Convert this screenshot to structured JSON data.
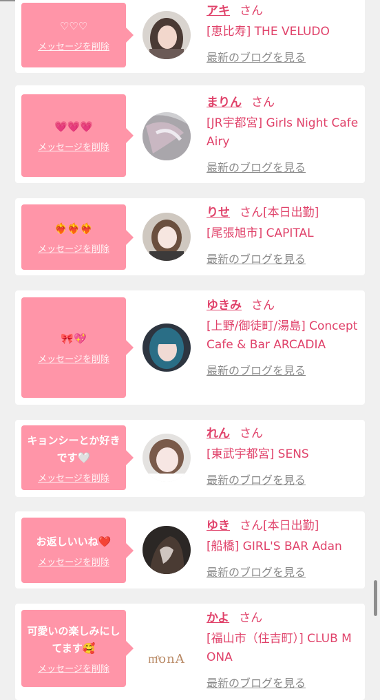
{
  "colors": {
    "accent": "#e0426a",
    "bubble": "#ff95a8",
    "background": "#f0f0f0"
  },
  "icons": {
    "heart_emoji_font": "♡",
    "white_heart": "🤍",
    "red_heart": "❤️",
    "smiling_hearts": "🥰"
  },
  "entries": [
    {
      "message": "♡♡♡",
      "delete_label": "メッセージを削除",
      "name": "アキ",
      "honorific": "さん",
      "status": "",
      "shop": "[恵比寿] THE VELUDO",
      "blog_link": "最新のブログを見る"
    },
    {
      "message": "💗💗💗",
      "delete_label": "メッセージを削除",
      "name": "まりん",
      "honorific": "さん",
      "status": "",
      "shop": "[JR宇都宮] Girls Night Cafe Airy",
      "blog_link": "最新のブログを見る"
    },
    {
      "message": "❤️‍🔥❤️‍🔥❤️‍🔥",
      "delete_label": "メッセージを削除",
      "name": "りせ",
      "honorific": "さん",
      "status": "[本日出勤]",
      "shop": "[尾張旭市] CAPITAL",
      "blog_link": "最新のブログを見る"
    },
    {
      "message": "🎀💖",
      "delete_label": "メッセージを削除",
      "name": "ゆきみ",
      "honorific": "さん",
      "status": "",
      "shop": "[上野/御徒町/湯島] Concept Cafe & Bar ARCADIA",
      "blog_link": "最新のブログを見る"
    },
    {
      "message": "キョンシーとか好きです🤍",
      "delete_label": "メッセージを削除",
      "name": "れん",
      "honorific": "さん",
      "status": "",
      "shop": "[東武宇都宮] SENS",
      "blog_link": "最新のブログを見る"
    },
    {
      "message": "お返しいいね❤️",
      "delete_label": "メッセージを削除",
      "name": "ゆき",
      "honorific": "さん",
      "status": "[本日出勤]",
      "shop": "[船橋] GIRL'S BAR Adan",
      "blog_link": "最新のブログを見る"
    },
    {
      "message": "可愛いの楽しみにしてます🥰",
      "delete_label": "メッセージを削除",
      "name": "かよ",
      "honorific": "さん",
      "status": "",
      "shop": "[福山市（住吉町）] CLUB MONA",
      "blog_link": "最新のブログを見る",
      "logo_text": "mͦonA"
    }
  ]
}
